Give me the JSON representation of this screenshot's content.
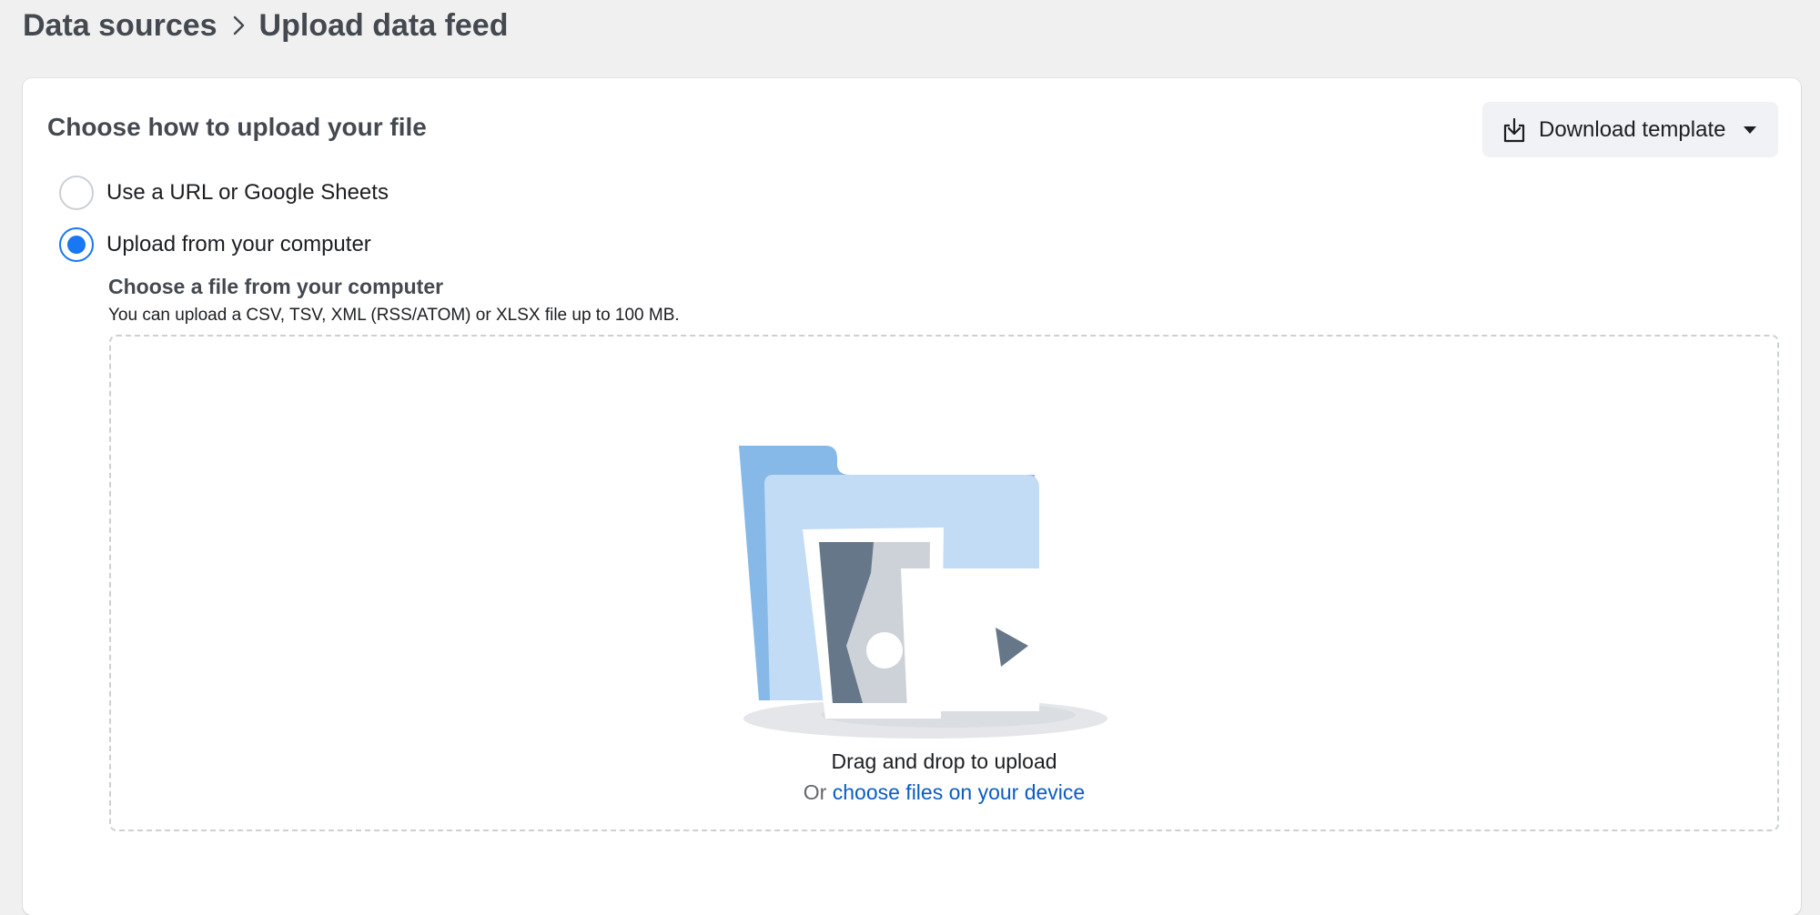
{
  "breadcrumb": {
    "items": [
      "Data sources",
      "Upload data feed"
    ]
  },
  "card": {
    "title": "Choose how to upload your file",
    "download_button": {
      "label": "Download template",
      "icon": "download-icon"
    }
  },
  "upload_method": {
    "options": [
      {
        "label": "Use a URL or Google Sheets",
        "selected": false
      },
      {
        "label": "Upload from your computer",
        "selected": true
      }
    ]
  },
  "file_section": {
    "title": "Choose a file from your computer",
    "description": "You can upload a CSV, TSV, XML (RSS/ATOM) or XLSX file up to 100 MB."
  },
  "dropzone": {
    "title": "Drag and drop to upload",
    "prefix": "Or",
    "link": "choose files on your device"
  },
  "colors": {
    "accent": "#1877f2",
    "link": "#0a5dc2",
    "folder_back": "#86b9e8",
    "folder_front": "#c2dcf5"
  }
}
